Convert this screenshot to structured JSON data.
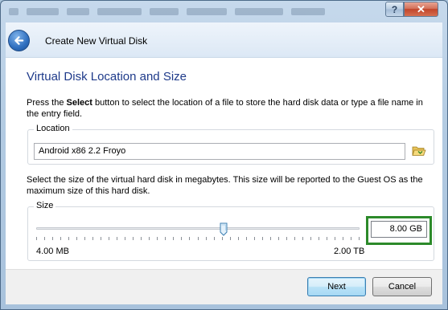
{
  "window": {
    "help_label": "?",
    "close_label": "✕"
  },
  "header": {
    "title": "Create New Virtual Disk",
    "back_icon": "back-arrow-icon"
  },
  "page": {
    "title": "Virtual Disk Location and Size",
    "description_prefix": "Press the ",
    "description_bold": "Select",
    "description_suffix": " button to select the location of a file to store the hard disk data or type a file name in the entry field."
  },
  "location": {
    "group_label": "Location",
    "value": "Android x86 2.2 Froyo",
    "folder_icon": "folder-open-icon"
  },
  "size": {
    "description": "Select the size of the virtual hard disk in megabytes. This size will be reported to the Guest OS as the maximum size of this hard disk.",
    "group_label": "Size",
    "value": "8.00 GB",
    "min_label": "4.00 MB",
    "max_label": "2.00 TB",
    "slider_fraction": 0.58,
    "highlight_color": "#2c8a2a"
  },
  "buttons": {
    "next": "Next",
    "cancel": "Cancel"
  }
}
